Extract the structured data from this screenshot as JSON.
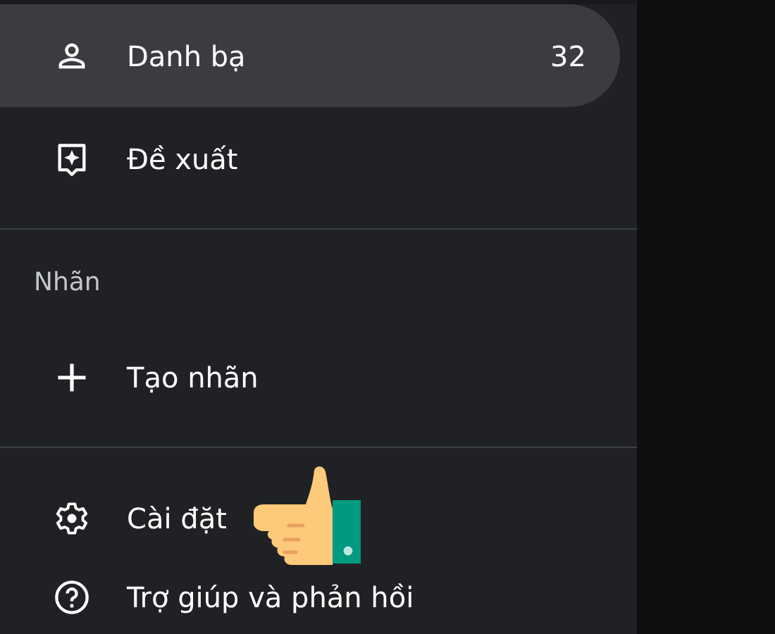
{
  "sections": [
    {
      "items": [
        {
          "label": "Danh bạ",
          "count": "32",
          "selected": true
        },
        {
          "label": "Đề xuất",
          "selected": false
        }
      ]
    },
    {
      "heading": "Nhãn",
      "items": [
        {
          "label": "Tạo nhãn",
          "selected": false
        }
      ]
    },
    {
      "items": [
        {
          "label": "Cài đặt",
          "selected": false,
          "pointer": true
        },
        {
          "label": "Trợ giúp và phản hồi",
          "selected": false
        }
      ]
    }
  ]
}
